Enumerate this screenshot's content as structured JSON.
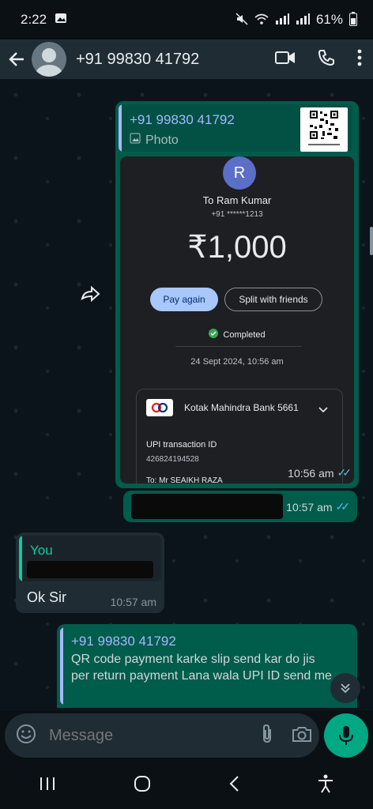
{
  "status_bar": {
    "time": "2:22",
    "battery": "61%"
  },
  "header": {
    "contact": "+91 99830 41792"
  },
  "messages": {
    "payment": {
      "quote_name": "+91 99830 41792",
      "quote_type": "Photo",
      "avatar_letter": "R",
      "to_name": "To Ram Kumar",
      "to_phone": "+91 ******1213",
      "amount": "₹1,000",
      "pay_again": "Pay again",
      "split": "Split with friends",
      "status": "Completed",
      "date": "24 Sept 2024, 10:56 am",
      "bank": "Kotak Mahindra Bank 5661",
      "upi_label": "UPI transaction ID",
      "upi_id": "426824194528",
      "to_line": "To: Mr SEAIKH RAZA",
      "time": "10:56 am"
    },
    "redacted_out": {
      "time": "10:57 am"
    },
    "reply": {
      "quote_name": "You",
      "text": "Ok Sir",
      "time": "10:57 am"
    },
    "last": {
      "quote_name": "+91 99830 41792",
      "text": "QR code payment karke slip send kar do jis per return payment Lana wala UPI ID send me"
    }
  },
  "composer": {
    "placeholder": "Message"
  },
  "colors": {
    "outgoing": "#005c4b",
    "incoming": "#1f2c34",
    "accent": "#00a884",
    "read_ticks": "#53bdeb"
  }
}
